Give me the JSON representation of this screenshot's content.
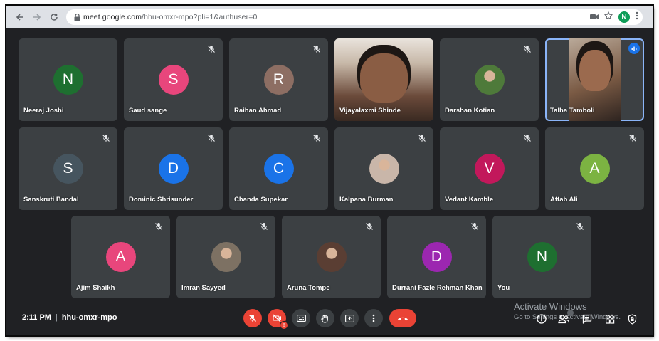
{
  "browser": {
    "url_host": "meet.google.com",
    "url_path": "/hhu-omxr-mpo?pli=1&authuser=0",
    "profile_initial": "N"
  },
  "participants": [
    {
      "name": "Neeraj Joshi",
      "initial": "N",
      "color": "#1e6f30",
      "type": "letter",
      "muted": false
    },
    {
      "name": "Saud sange",
      "initial": "S",
      "color": "#e8467c",
      "type": "letter",
      "muted": true
    },
    {
      "name": "Raihan Ahmad",
      "initial": "R",
      "color": "#8d6e63",
      "type": "letter",
      "muted": true
    },
    {
      "name": "Vijayalaxmi Shinde",
      "initial": "",
      "color": "#6b4a3a",
      "type": "video",
      "muted": false
    },
    {
      "name": "Darshan Kotian",
      "initial": "",
      "color": "#4e7a3a",
      "type": "photo",
      "muted": true
    },
    {
      "name": "Talha Tamboli",
      "initial": "",
      "color": "#7a5a44",
      "type": "video",
      "muted": false,
      "speaking": true
    },
    {
      "name": "Sanskruti Bandal",
      "initial": "S",
      "color": "#46555f",
      "type": "letter",
      "muted": true
    },
    {
      "name": "Dominic Shrisunder",
      "initial": "D",
      "color": "#1a73e8",
      "type": "letter",
      "muted": true
    },
    {
      "name": "Chanda Supekar",
      "initial": "C",
      "color": "#1a73e8",
      "type": "letter",
      "muted": true
    },
    {
      "name": "Kalpana Burman",
      "initial": "",
      "color": "#c9b6a9",
      "type": "photo",
      "muted": true
    },
    {
      "name": "Vedant Kamble",
      "initial": "V",
      "color": "#c2185b",
      "type": "letter",
      "muted": true
    },
    {
      "name": "Aftab Ali",
      "initial": "A",
      "color": "#7cb342",
      "type": "letter",
      "muted": true
    },
    {
      "name": "Ajim Shaikh",
      "initial": "A",
      "color": "#e8467c",
      "type": "letter",
      "muted": true
    },
    {
      "name": "Imran Sayyed",
      "initial": "",
      "color": "#7d7163",
      "type": "photo",
      "muted": true
    },
    {
      "name": "Aruna Tompe",
      "initial": "",
      "color": "#5a3e33",
      "type": "photo",
      "muted": true
    },
    {
      "name": "Durrani Fazle Rehman Khan",
      "initial": "D",
      "color": "#9c27b0",
      "type": "letter",
      "muted": true
    },
    {
      "name": "You",
      "initial": "N",
      "color": "#1e6f30",
      "type": "letter",
      "muted": true
    }
  ],
  "meeting": {
    "time": "2:11 PM",
    "separator": "|",
    "code": "hhu-omxr-mpo"
  },
  "controls": {
    "mic": "mic-off-icon",
    "camera": "camera-off-icon",
    "captions": "captions-icon",
    "hand": "raise-hand-icon",
    "present": "present-icon",
    "more": "more-options-icon",
    "end": "end-call-icon",
    "danger_color": "#ea4335"
  },
  "watermark": {
    "line1": "Activate Windows",
    "line2": "Go to Settings to activate Windows."
  }
}
